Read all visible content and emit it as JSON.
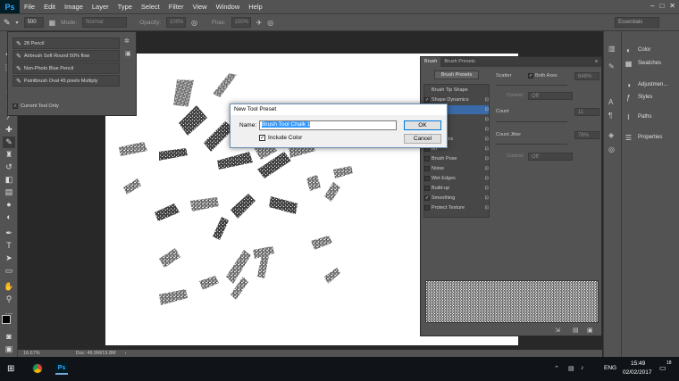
{
  "app": {
    "logo": "Ps",
    "accent": "#31a8ff"
  },
  "menu": [
    "File",
    "Edit",
    "Image",
    "Layer",
    "Type",
    "Select",
    "Filter",
    "View",
    "Window",
    "Help"
  ],
  "options_bar": {
    "brush_size": "500",
    "mode_label": "Mode:",
    "mode_value": "Normal",
    "opacity_label": "Opacity:",
    "opacity_value": "100%",
    "flow_label": "Flow:",
    "flow_value": "100%",
    "workspace": "Essentials"
  },
  "tool_presets": {
    "items": [
      "28 Pencil",
      "Airbrush Soft Round 50% flow",
      "Non-Photo Blue Pencil",
      "Paintbrush Oval 45 pixels Multiply"
    ],
    "current_tool_only": "Current Tool Only"
  },
  "brush_panel": {
    "tabs": [
      "Brush",
      "Brush Presets"
    ],
    "brush_presets_button": "Brush Presets",
    "list": [
      {
        "label": "Brush Tip Shape",
        "checkbox": false,
        "checked": false
      },
      {
        "label": "Shape Dynamics",
        "checkbox": true,
        "checked": true
      },
      {
        "label": "ring",
        "checkbox": true,
        "checked": true
      },
      {
        "label": "re",
        "checkbox": true,
        "checked": false
      },
      {
        "label": "Brush",
        "checkbox": true,
        "checked": false
      },
      {
        "label": "Dynamics",
        "checkbox": true,
        "checked": false
      },
      {
        "label": "fer",
        "checkbox": true,
        "checked": false
      },
      {
        "label": "Brush Pose",
        "checkbox": true,
        "checked": false
      },
      {
        "label": "Noise",
        "checkbox": true,
        "checked": false
      },
      {
        "label": "Wet Edges",
        "checkbox": true,
        "checked": false
      },
      {
        "label": "Build-up",
        "checkbox": true,
        "checked": false
      },
      {
        "label": "Smoothing",
        "checkbox": true,
        "checked": true
      },
      {
        "label": "Protect Texture",
        "checkbox": true,
        "checked": false
      }
    ],
    "scatter_label": "Scatter",
    "both_axes_label": "Both Axes",
    "scatter_value": "648%",
    "control_label": "Control:",
    "control_value": "Off",
    "count_label": "Count",
    "count_value": "11",
    "count_jitter_label": "Count Jitter",
    "count_jitter_value": "78%",
    "control2_value": "Off"
  },
  "dock": [
    {
      "icon": "color-icon",
      "label": "Color"
    },
    {
      "icon": "swatches-icon",
      "label": "Swatches"
    },
    {
      "icon": "adjustments-icon",
      "label": "Adjustmen..."
    },
    {
      "icon": "styles-icon",
      "label": "Styles"
    },
    {
      "icon": "paths-icon",
      "label": "Paths"
    },
    {
      "icon": "properties-icon",
      "label": "Properties"
    }
  ],
  "dialog": {
    "title": "New Tool Preset",
    "name_label": "Name:",
    "name_value": "Brush Tool Chalk 1",
    "include_color": "Include Color",
    "ok": "OK",
    "cancel": "Cancel"
  },
  "status": {
    "zoom": "16.67%",
    "doc": "Doc: 49.9M/19.8M"
  },
  "taskbar": {
    "lang": "ENG",
    "time": "15:49",
    "date": "02/02/2017",
    "notification_count": "18"
  }
}
